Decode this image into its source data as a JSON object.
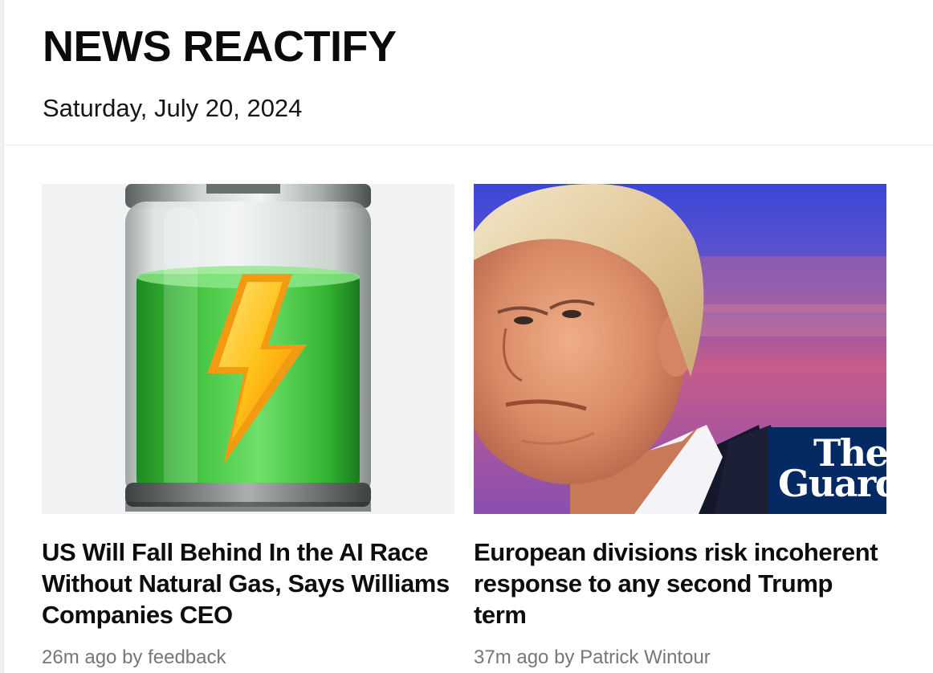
{
  "header": {
    "site_title": "NEWS REACTIFY",
    "date": "Saturday, July 20, 2024"
  },
  "articles": [
    {
      "image_subject": "battery-charging-icon",
      "title": "US Will Fall Behind In the AI Race Without Natural Gas, Says Williams Companies CEO",
      "meta": "26m ago by feedback"
    },
    {
      "image_subject": "politician-portrait-photo",
      "image_badge": {
        "line1": "The",
        "line2": "Guardian"
      },
      "title": "European divisions risk incoherent response to any second Trump term",
      "meta": "37m ago by Patrick Wintour"
    }
  ],
  "colors": {
    "guardian_blue": "#052962",
    "meta_gray": "#777777",
    "battery_green": "#3bbf3a"
  }
}
